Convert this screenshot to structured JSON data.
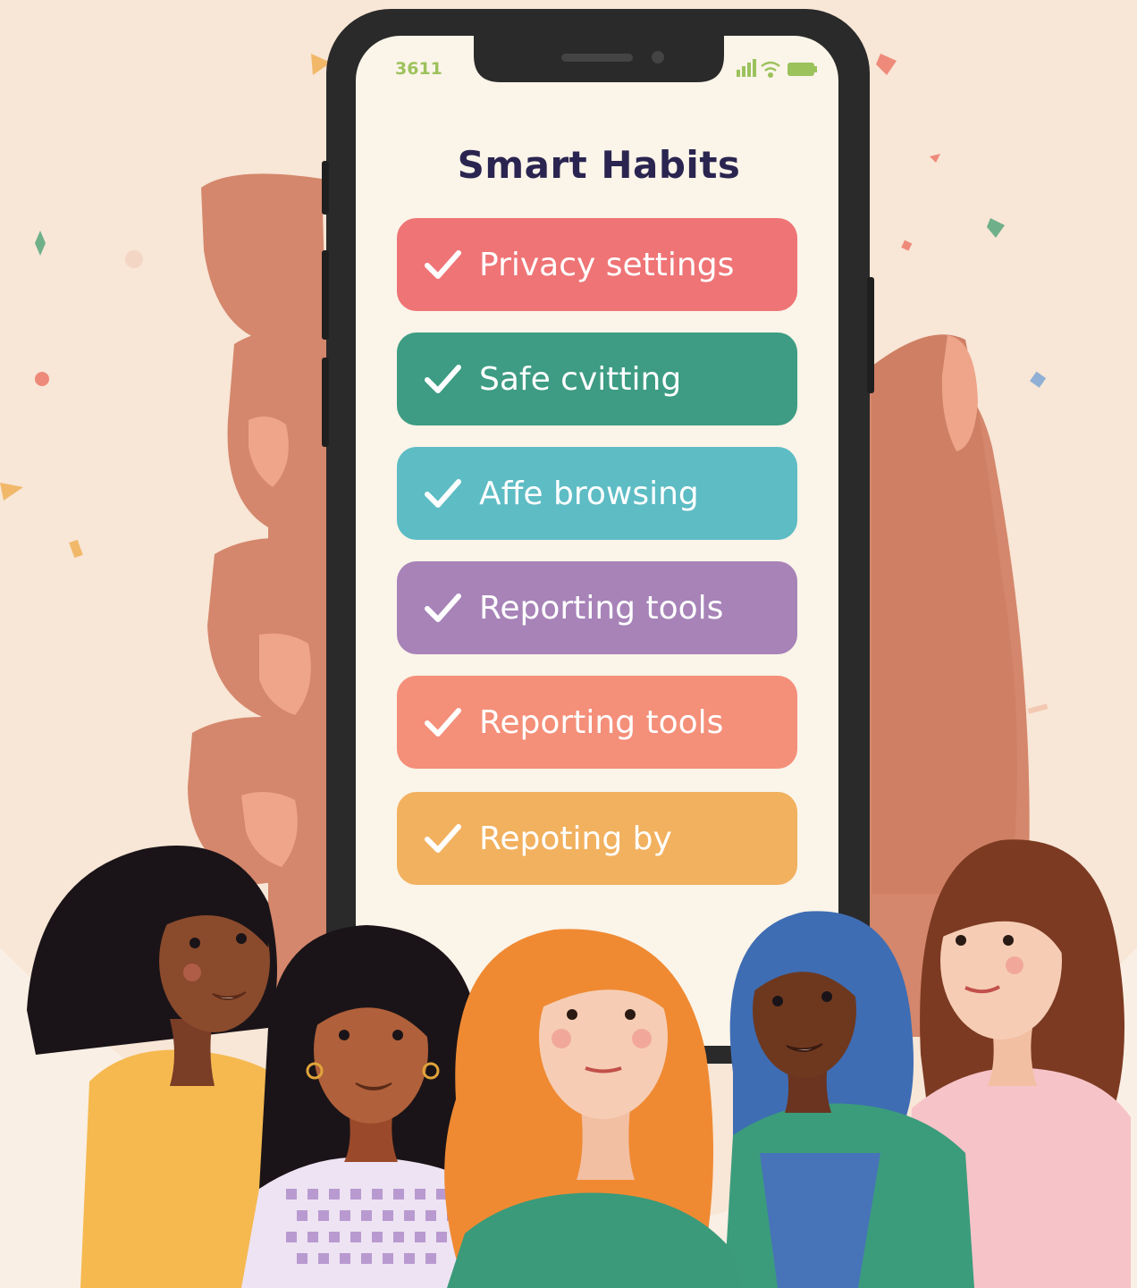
{
  "status_bar": {
    "time": "3611",
    "signal_icon": "signal-bars-icon",
    "wifi_icon": "wifi-icon",
    "battery_icon": "battery-icon"
  },
  "screen": {
    "title": "Smart Habits",
    "habits": [
      {
        "label": "Privacy settings",
        "color": "#ef7476",
        "icon": "check-icon"
      },
      {
        "label": "Safe cvitting",
        "color": "#3d9c83",
        "icon": "check-icon"
      },
      {
        "label": "Affe browsing",
        "color": "#5dbcc4",
        "icon": "check-icon"
      },
      {
        "label": "Reporting tools",
        "color": "#a783b8",
        "icon": "check-icon"
      },
      {
        "label": "Reporting tools",
        "color": "#f48f79",
        "icon": "check-icon"
      },
      {
        "label": "Repoting by",
        "color": "#f2b15f",
        "icon": "check-icon"
      }
    ]
  },
  "colors": {
    "background": "#f8e6d6",
    "skin_hand": "#d4876c",
    "phone_frame": "#2a2a2a",
    "screen_bg": "#fbf4e9",
    "title_text": "#2a2550"
  }
}
